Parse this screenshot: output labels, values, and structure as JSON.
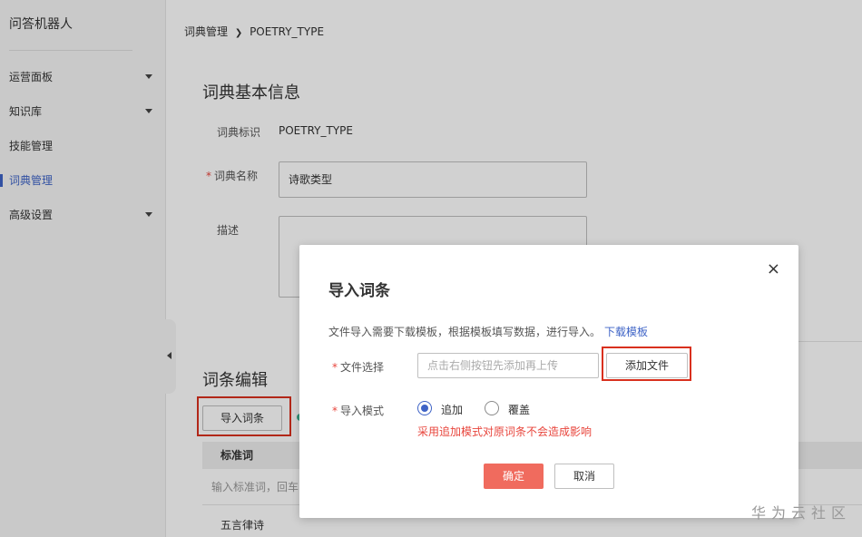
{
  "app": {
    "title": "问答机器人"
  },
  "sidebar": {
    "items": [
      {
        "label": "运营面板",
        "has_arrow": true
      },
      {
        "label": "知识库",
        "has_arrow": true
      },
      {
        "label": "技能管理",
        "has_arrow": false
      },
      {
        "label": "词典管理",
        "has_arrow": false,
        "active": true
      },
      {
        "label": "高级设置",
        "has_arrow": true
      }
    ]
  },
  "breadcrumb": {
    "parent": "词典管理",
    "current": "POETRY_TYPE"
  },
  "basic_info": {
    "title": "词典基本信息",
    "id_label": "词典标识",
    "id_value": "POETRY_TYPE",
    "name_label": "词典名称",
    "name_value": "诗歌类型",
    "desc_label": "描述"
  },
  "entries": {
    "title": "词条编辑",
    "import_button": "导入词条",
    "column_standard": "标准词",
    "input_placeholder": "输入标准词，回车",
    "row1": "五言律诗"
  },
  "modal": {
    "title": "导入词条",
    "hint": "文件导入需要下载模板，根据模板填写数据，进行导入。",
    "download_link": "下载模板",
    "file_label": "文件选择",
    "file_placeholder": "点击右侧按钮先添加再上传",
    "add_file": "添加文件",
    "mode_label": "导入模式",
    "mode_append": "追加",
    "mode_overwrite": "覆盖",
    "mode_selected": "append",
    "warning": "采用追加模式对原词条不会造成影响",
    "ok": "确定",
    "cancel": "取消",
    "close_icon": "×"
  },
  "watermark": "华为云社区",
  "colors": {
    "accent": "#3e63c6",
    "danger": "#e8453c",
    "primary_button": "#f06b5e",
    "highlight": "#d9301e"
  }
}
